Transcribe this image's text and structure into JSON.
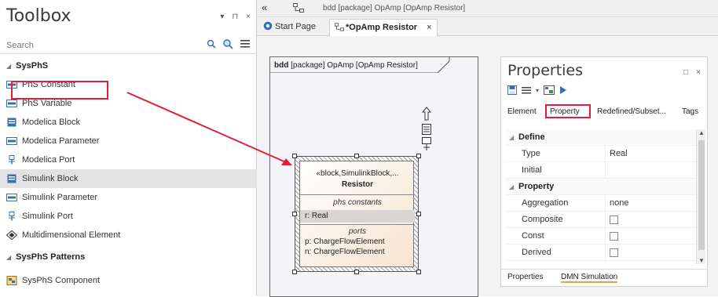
{
  "toolbox": {
    "title": "Toolbox",
    "controls": [
      "▾",
      "⊓",
      "×"
    ],
    "search_placeholder": "Search",
    "groups": [
      {
        "name": "SysPhS",
        "items": [
          {
            "label": "PhS Constant",
            "icon": "constant-icon"
          },
          {
            "label": "PhS Variable",
            "icon": "variable-icon"
          },
          {
            "label": "Modelica Block",
            "icon": "block-icon"
          },
          {
            "label": "Modelica Parameter",
            "icon": "parameter-icon"
          },
          {
            "label": "Modelica Port",
            "icon": "port-icon"
          },
          {
            "label": "Simulink Block",
            "icon": "block-icon"
          },
          {
            "label": "Simulink Parameter",
            "icon": "parameter-icon"
          },
          {
            "label": "Simulink Port",
            "icon": "port-icon"
          },
          {
            "label": "Multidimensional Element",
            "icon": "multidimensional-icon"
          }
        ]
      },
      {
        "name": "SysPhS Patterns",
        "items": [
          {
            "label": "SysPhS Component",
            "icon": "component-icon"
          }
        ]
      }
    ],
    "selected_item": "Simulink Block",
    "highlighted_item": "PhS Constant"
  },
  "diagram": {
    "back_label": "«",
    "path": "bdd [package] OpAmp [OpAmp Resistor]",
    "tabs": [
      {
        "label": "Start Page"
      },
      {
        "label": "*OpAmp Resistor",
        "close": "×"
      }
    ],
    "frame_label_kind": "bdd",
    "frame_label_rest": "[package] OpAmp [OpAmp Resistor]",
    "block": {
      "stereotype": "«block,SimulinkBlock,...",
      "name": "Resistor",
      "compartment1": "phs constants",
      "attr1": "r: Real",
      "compartment2": "ports",
      "ports": [
        "p: ChargeFlowElement",
        "n: ChargeFlowElement"
      ]
    }
  },
  "properties": {
    "title": "Properties",
    "controls": [
      "□",
      "×"
    ],
    "tabs": [
      "Element",
      "Property",
      "Redefined/Subset...",
      "Tags"
    ],
    "active_tab": "Property",
    "sections": [
      {
        "name": "Define",
        "rows": [
          {
            "key": "Type",
            "value": "Real"
          },
          {
            "key": "Initial",
            "value": ""
          }
        ]
      },
      {
        "name": "Property",
        "rows": [
          {
            "key": "Aggregation",
            "value": "none"
          },
          {
            "key": "Composite",
            "value": "checkbox"
          },
          {
            "key": "Const",
            "value": "checkbox"
          },
          {
            "key": "Derived",
            "value": "checkbox"
          }
        ]
      }
    ],
    "bottom_tabs": [
      "Properties",
      "DMN Simulation"
    ],
    "highlight_color": "#e0203a"
  }
}
